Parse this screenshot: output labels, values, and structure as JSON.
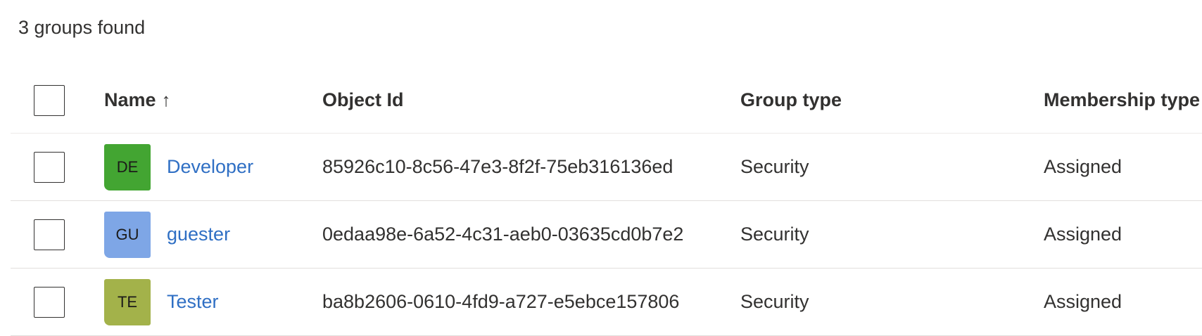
{
  "summary": {
    "count_text": "3 groups found"
  },
  "columns": {
    "name": "Name",
    "name_sort_icon": "↑",
    "object_id": "Object Id",
    "group_type": "Group type",
    "membership_type": "Membership type"
  },
  "rows": [
    {
      "initials": "DE",
      "avatar_color": "#43a532",
      "name": "Developer",
      "object_id": "85926c10-8c56-47e3-8f2f-75eb316136ed",
      "group_type": "Security",
      "membership_type": "Assigned"
    },
    {
      "initials": "GU",
      "avatar_color": "#7ea6e6",
      "name": "guester",
      "object_id": "0edaa98e-6a52-4c31-aeb0-03635cd0b7e2",
      "group_type": "Security",
      "membership_type": "Assigned"
    },
    {
      "initials": "TE",
      "avatar_color": "#a3b24a",
      "name": "Tester",
      "object_id": "ba8b2606-0610-4fd9-a727-e5ebce157806",
      "group_type": "Security",
      "membership_type": "Assigned"
    }
  ]
}
